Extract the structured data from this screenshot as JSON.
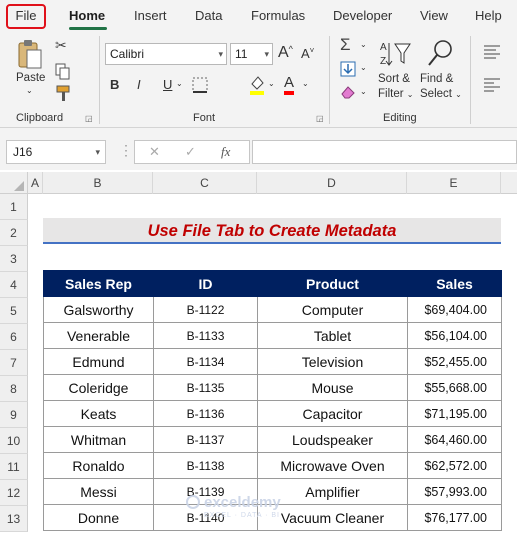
{
  "ribbon_tabs": {
    "file": "File",
    "home": "Home",
    "insert": "Insert",
    "data": "Data",
    "formulas": "Formulas",
    "developer": "Developer",
    "view": "View",
    "help": "Help"
  },
  "ribbon": {
    "clipboard": {
      "paste_label": "Paste",
      "group_label": "Clipboard"
    },
    "font": {
      "font_name": "Calibri",
      "font_size": "11",
      "bold": "B",
      "italic": "I",
      "underline": "U",
      "group_label": "Font",
      "grow_font": "A",
      "shrink_font": "A"
    },
    "editing": {
      "sort_filter_line1": "Sort &",
      "sort_filter_line2": "Filter",
      "find_select_line1": "Find &",
      "find_select_line2": "Select",
      "group_label": "Editing"
    },
    "icons": [
      "cut-icon",
      "copy-icon",
      "format-painter-icon",
      "autosum-icon",
      "fill-icon",
      "clear-icon",
      "sort-filter-icon",
      "find-icon",
      "align-icon"
    ]
  },
  "formula_bar": {
    "name_box": "J16",
    "fx_label": "fx",
    "cancel_symbol": "✕",
    "enter_symbol": "✓",
    "value": ""
  },
  "grid": {
    "columns": [
      "A",
      "B",
      "C",
      "D",
      "E"
    ],
    "rows": [
      "1",
      "2",
      "3",
      "4",
      "5",
      "6",
      "7",
      "8",
      "9",
      "10",
      "11",
      "12",
      "13"
    ]
  },
  "sheet": {
    "title": "Use File Tab to Create Metadata",
    "headers": {
      "sales_rep": "Sales Rep",
      "id": "ID",
      "product": "Product",
      "sales": "Sales"
    },
    "records": [
      {
        "rep": "Galsworthy",
        "id": "B-1122",
        "product": "Computer",
        "sales": "$69,404.00"
      },
      {
        "rep": "Venerable",
        "id": "B-1133",
        "product": "Tablet",
        "sales": "$56,104.00"
      },
      {
        "rep": "Edmund",
        "id": "B-1134",
        "product": "Television",
        "sales": "$52,455.00"
      },
      {
        "rep": "Coleridge",
        "id": "B-1135",
        "product": "Mouse",
        "sales": "$55,668.00"
      },
      {
        "rep": "Keats",
        "id": "B-1136",
        "product": "Capacitor",
        "sales": "$71,195.00"
      },
      {
        "rep": "Whitman",
        "id": "B-1137",
        "product": "Loudspeaker",
        "sales": "$64,460.00"
      },
      {
        "rep": "Ronaldo",
        "id": "B-1138",
        "product": "Microwave Oven",
        "sales": "$62,572.00"
      },
      {
        "rep": "Messi",
        "id": "B-1139",
        "product": "Amplifier",
        "sales": "$57,993.00"
      },
      {
        "rep": "Donne",
        "id": "B-1140",
        "product": "Vacuum Cleaner",
        "sales": "$76,177.00"
      }
    ]
  },
  "watermark": {
    "brand": "exceldemy",
    "tagline": "EXCEL · DATA · BI"
  },
  "colors": {
    "header_fill": "#002060",
    "title_text": "#c00000",
    "title_fill": "#e7e6e6",
    "file_highlight": "#e0101a",
    "home_underline": "#217346"
  }
}
